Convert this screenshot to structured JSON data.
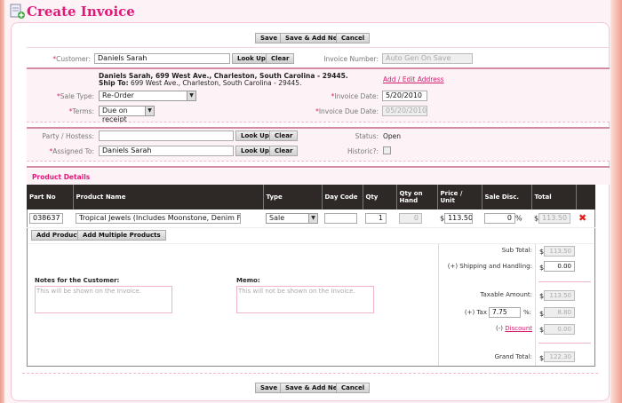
{
  "header": {
    "title": "Create Invoice",
    "icon": "invoice-add-icon"
  },
  "buttons": {
    "save": "Save",
    "save_add": "Save & Add New",
    "cancel": "Cancel",
    "lookup": "Look Up",
    "clear": "Clear",
    "add_product": "Add Product",
    "add_multiple": "Add Multiple Products"
  },
  "customer": {
    "label": "Customer:",
    "value": "Daniels Sarah",
    "address": "Daniels Sarah, 699 West Ave., Charleston, South Carolina - 29445.",
    "ship_label": "Ship To:",
    "ship_to": "699 West Ave., Charleston, South Carolina - 29445."
  },
  "invoice_number": {
    "label": "Invoice Number:",
    "placeholder": "Auto Gen On Save"
  },
  "add_edit_address": "Add / Edit Address",
  "sale_type": {
    "label": "Sale Type:",
    "value": "Re-Order"
  },
  "terms": {
    "label": "Terms:",
    "value": "Due on receipt"
  },
  "invoice_date": {
    "label": "Invoice Date:",
    "value": "5/20/2010"
  },
  "due_date": {
    "label": "Invoice Due Date:",
    "value": "05/20/2010"
  },
  "party": {
    "label": "Party / Hostess:",
    "value": ""
  },
  "assigned": {
    "label": "Assigned To:",
    "value": "Daniels Sarah"
  },
  "status": {
    "label": "Status:",
    "value": "Open"
  },
  "historic": {
    "label": "Historic?:",
    "checked": false
  },
  "products": {
    "title": "Product Details",
    "columns": [
      "Part No",
      "Product Name",
      "Type",
      "Day Code",
      "Qty",
      "Qty on Hand",
      "Price / Unit",
      "Sale Disc.",
      "Total"
    ],
    "rows": [
      {
        "part_no": "038637",
        "name": "Tropical Jewels (Includes Moonstone, Denim Frost and",
        "type": "Sale",
        "day_code": "",
        "qty": "1",
        "on_hand": "0",
        "price": "113.50",
        "disc": "0",
        "total": "113.50"
      }
    ]
  },
  "notes": {
    "label": "Notes for the Customer:",
    "placeholder": "This will be shown on the Invoice."
  },
  "memo": {
    "label": "Memo:",
    "placeholder": "This will not be shown on the Invoice."
  },
  "totals": {
    "currency": "$",
    "percent": "%",
    "pct_label": "%:",
    "subtotal_label": "Sub Total:",
    "subtotal": "113.50",
    "shipping_label": "(+) Shipping and Handling:",
    "shipping": "0.00",
    "taxable_label": "Taxable Amount:",
    "taxable": "113.50",
    "tax_label": "(+) Tax",
    "tax_rate": "7.75",
    "tax": "8.80",
    "discount_prefix": "(-)",
    "discount_link": "Discount",
    "discount": "0.00",
    "grand_label": "Grand Total:",
    "grand": "122.30"
  },
  "required_mark": "*"
}
